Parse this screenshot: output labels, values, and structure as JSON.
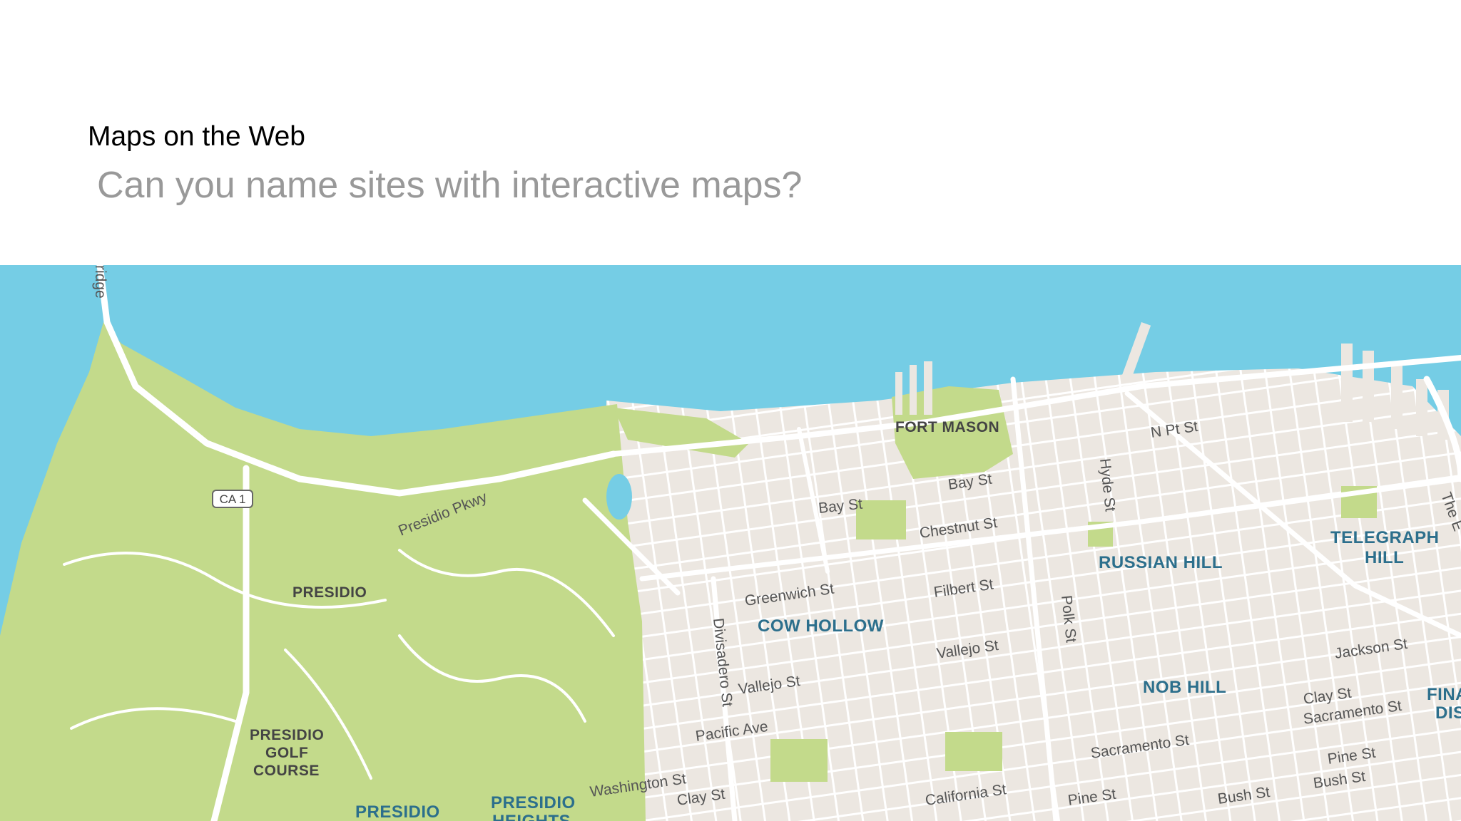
{
  "slide": {
    "title": "Maps on the Web",
    "subtitle": "Can you name sites with interactive maps?"
  },
  "map": {
    "colors": {
      "water": "#75cde5",
      "park": "#c3da8b",
      "land": "#ece7e1",
      "road": "#ffffff"
    },
    "neighborhoods": {
      "fort_mason": "FORT MASON",
      "russian_hill": "RUSSIAN HILL",
      "telegraph_hill_1": "TELEGRAPH",
      "telegraph_hill_2": "HILL",
      "cow_hollow": "COW HOLLOW",
      "nob_hill": "NOB HILL",
      "presidio": "PRESIDIO",
      "golf_1": "PRESIDIO",
      "golf_2": "GOLF",
      "golf_3": "COURSE",
      "presidio_bottom": "PRESIDIO",
      "presidio_heights_1": "PRESIDIO",
      "presidio_heights_2": "HEIGHTS",
      "financial_1": "FINA",
      "financial_2": "DIS"
    },
    "streets": {
      "bridge": "ridge",
      "ca1": "CA 1",
      "presidio_pkwy": "Presidio Pkwy",
      "bay_st_1": "Bay St",
      "bay_st_2": "Bay St",
      "chestnut": "Chestnut St",
      "n_pt": "N Pt St",
      "hyde": "Hyde St",
      "greenwich": "Greenwich St",
      "filbert": "Filbert St",
      "polk": "Polk St",
      "divisadero": "Divisadero St",
      "vallejo_1": "Vallejo St",
      "vallejo_2": "Vallejo St",
      "pacific": "Pacific Ave",
      "washington": "Washington St",
      "clay_1": "Clay St",
      "clay_2": "Clay St",
      "california": "California St",
      "pine_1": "Pine St",
      "pine_2": "Pine St",
      "sacramento_1": "Sacramento St",
      "sacramento_2": "Sacramento St",
      "bush_1": "Bush St",
      "bush_2": "Bush St",
      "jackson": "Jackson St",
      "the_e": "The E"
    }
  }
}
